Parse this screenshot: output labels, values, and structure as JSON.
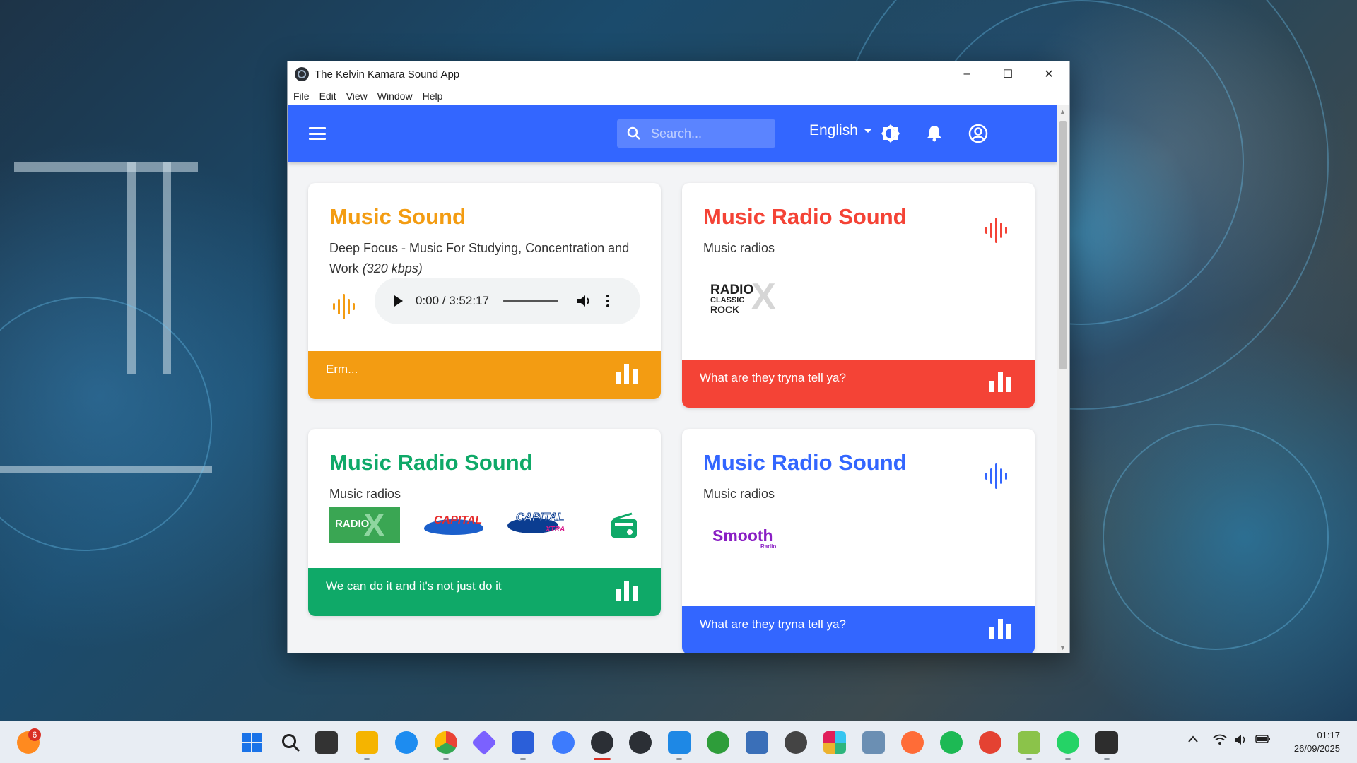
{
  "window": {
    "title": "The Kelvin Kamara Sound App",
    "controls": {
      "minimize": "–",
      "maximize": "☐",
      "close": "✕"
    }
  },
  "menu": [
    "File",
    "Edit",
    "View",
    "Window",
    "Help"
  ],
  "header": {
    "search_placeholder": "Search...",
    "language": "English",
    "icons": [
      "menu-icon",
      "search-icon",
      "brightness-icon",
      "bell-icon",
      "account-icon"
    ],
    "color": "#3366ff"
  },
  "cards": [
    {
      "title": "Music Sound",
      "subtitle_main": "Deep Focus - Music For Studying, Concentration and Work",
      "subtitle_bitrate": "(320 kbps)",
      "player_time": "0:00 / 3:52:17",
      "footer": "Erm...",
      "accent": "#f39c12"
    },
    {
      "title": "Music Radio Sound",
      "subtitle": "Music radios",
      "logo_main": "RADIO",
      "logo_line2": "CLASSIC",
      "logo_line3": "ROCK",
      "footer": "What are they tryna tell ya?",
      "accent": "#f44336"
    },
    {
      "title": "Music Radio Sound",
      "subtitle": "Music radios",
      "logos": [
        "RADIO",
        "CAPITAL",
        "CAPITAL",
        "XTRA"
      ],
      "footer": "We can do it and it's not just do it",
      "accent": "#0fa968"
    },
    {
      "title": "Music Radio Sound",
      "subtitle": "Music radios",
      "logo_main": "Smooth",
      "logo_sub": "Radio",
      "footer": "What are they tryna tell ya?",
      "accent": "#3366ff"
    }
  ],
  "taskbar": {
    "badge": "6",
    "clock_time": "01:17",
    "clock_date": "26/09/2025"
  }
}
